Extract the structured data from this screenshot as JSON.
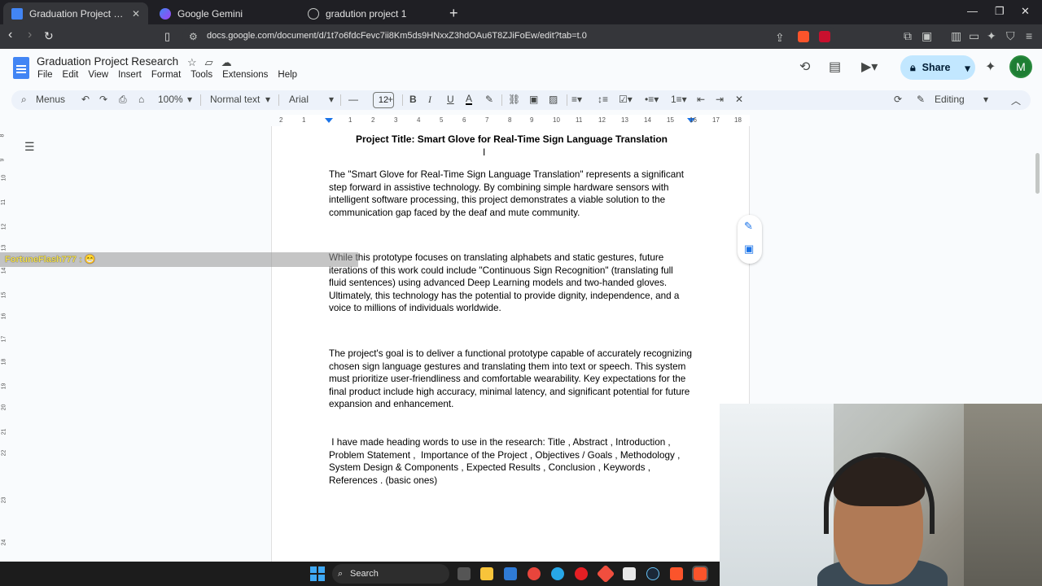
{
  "browser": {
    "tabs": [
      {
        "title": "Graduation Project Research - Goo",
        "active": true,
        "favicon_color": "#4285f4"
      },
      {
        "title": "Google Gemini",
        "active": false,
        "favicon_color": "#8ab4f8"
      },
      {
        "title": "gradution project 1",
        "active": false,
        "favicon_color": "#c4c7c5"
      }
    ],
    "url": "docs.google.com/document/d/1t7o6fdcFevc7ii8Km5ds9HNxxZ3hdOAu6T8ZJiFoEw/edit?tab=t.0",
    "new_tab_label": "+",
    "win_minimize": "—",
    "win_restore": "❐",
    "win_close": "✕"
  },
  "docs_header": {
    "title": "Graduation Project Research",
    "menu": [
      "File",
      "Edit",
      "View",
      "Insert",
      "Format",
      "Tools",
      "Extensions",
      "Help"
    ],
    "share_label": "Share",
    "avatar_letter": "M"
  },
  "toolbar": {
    "menus_label": "Menus",
    "zoom": "100%",
    "style": "Normal text",
    "font": "Arial",
    "font_size": "12",
    "bold": "B",
    "italic": "I",
    "underline": "U",
    "text_color": "A",
    "mode": "Editing"
  },
  "ruler": {
    "ticks": [
      "2",
      "1",
      "1",
      "2",
      "3",
      "4",
      "5",
      "6",
      "7",
      "8",
      "9",
      "10",
      "11",
      "12",
      "13",
      "14",
      "15",
      "16",
      "17",
      "18"
    ]
  },
  "vertical_ruler": {
    "ticks": [
      "8",
      "9",
      "10",
      "11",
      "12",
      "13",
      "14",
      "15",
      "16",
      "17",
      "18",
      "19",
      "20",
      "21",
      "22",
      "23",
      "24"
    ]
  },
  "document": {
    "heading": "Project Title: Smart Glove for Real-Time Sign Language Translation",
    "paragraphs": [
      "The \"Smart Glove for Real-Time Sign Language Translation\" represents a significant step forward in assistive technology. By combining simple hardware sensors with intelligent software processing, this project demonstrates a viable solution to the communication gap faced by the deaf and mute community.",
      "While this prototype focuses on translating alphabets and static gestures, future iterations of this work could include \"Continuous Sign Recognition\" (translating full fluid sentences) using advanced Deep Learning models and two-handed gloves. Ultimately, this technology has the potential to provide dignity, independence, and a voice to millions of individuals worldwide.",
      "The project's goal is to deliver a functional prototype capable of accurately recognizing chosen sign language gestures and translating them into text or speech. This system must prioritize user-friendliness and comfortable wearability. Key expectations for the final product include high accuracy, minimal latency, and significant potential for future expansion and enhancement.",
      " I have made heading words to use in the research: Title , Abstract , Introduction , Problem Statement ,  Importance of the Project , Objectives / Goals , Methodology , System Design & Components , Expected Results , Conclusion , Keywords , References . (basic ones)"
    ]
  },
  "chat_overlay": {
    "username": "FortuneFlash777 :",
    "emote": "😁"
  },
  "taskbar": {
    "search_label": "Search"
  }
}
